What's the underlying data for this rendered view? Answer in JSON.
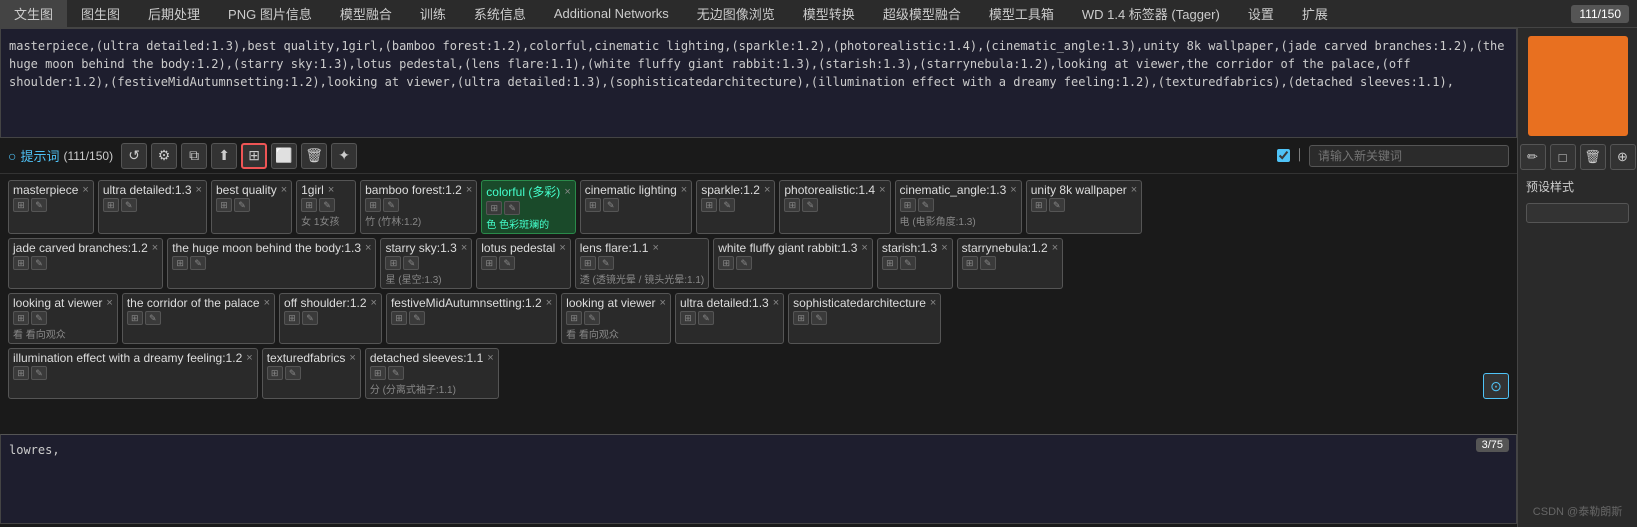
{
  "menu": {
    "items": [
      {
        "label": "文生图",
        "active": false
      },
      {
        "label": "图生图",
        "active": false
      },
      {
        "label": "后期处理",
        "active": false
      },
      {
        "label": "PNG 图片信息",
        "active": false
      },
      {
        "label": "模型融合",
        "active": false
      },
      {
        "label": "训练",
        "active": false
      },
      {
        "label": "系统信息",
        "active": false
      },
      {
        "label": "Additional Networks",
        "active": false
      },
      {
        "label": "无边图像浏览",
        "active": false
      },
      {
        "label": "模型转换",
        "active": false
      },
      {
        "label": "超级模型融合",
        "active": false
      },
      {
        "label": "模型工具箱",
        "active": false
      },
      {
        "label": "WD 1.4 标签器 (Tagger)",
        "active": false
      },
      {
        "label": "设置",
        "active": false
      },
      {
        "label": "扩展",
        "active": false
      }
    ],
    "counter": "111/150"
  },
  "positive_prompt": {
    "text": "masterpiece,(ultra detailed:1.3),best quality,1girl,(bamboo forest:1.2),colorful,cinematic lighting,(sparkle:1.2),(photorealistic:1.4),(cinematic_angle:1.3),unity 8k wallpaper,(jade carved branches:1.2),(the huge moon behind the body:1.2),(starry sky:1.3),lotus pedestal,(lens flare:1.1),(white fluffy giant rabbit:1.3),(starish:1.3),(starrynebula:1.2),looking at viewer,the corridor of the palace,(off shoulder:1.2),(festiveMidAutumnsetting:1.2),looking at viewer,(ultra detailed:1.3),(sophisticatedarchitecture),(illumination effect with a dreamy feeling:1.2),(texturedfabrics),(detached sleeves:1.1),"
  },
  "toolbar": {
    "prompt_label": "提示词",
    "prompt_count": "(111/150)",
    "keyword_placeholder": "请输入新关键词",
    "buttons": [
      {
        "id": "btn1",
        "icon": "↺",
        "title": "restore"
      },
      {
        "id": "btn2",
        "icon": "⚙",
        "title": "settings"
      },
      {
        "id": "btn3",
        "icon": "📋",
        "title": "copy"
      },
      {
        "id": "btn4",
        "icon": "⬆",
        "title": "import",
        "active": true
      },
      {
        "id": "btn5",
        "icon": "📄",
        "title": "page"
      },
      {
        "id": "btn6",
        "icon": "🗑",
        "title": "clear"
      },
      {
        "id": "btn7",
        "icon": "✨",
        "title": "magic"
      }
    ]
  },
  "tags_row1": [
    {
      "label": "masterpiece",
      "sub": "",
      "icons": 2
    },
    {
      "label": "ultra detailed:1.3",
      "sub": "",
      "icons": 2
    },
    {
      "label": "best quality",
      "sub": "",
      "icons": 2
    },
    {
      "label": "1girl",
      "sub": "女 1女孩",
      "icons": 2
    },
    {
      "label": "bamboo forest:1.2",
      "sub": "竹 (竹林:1.2)",
      "icons": 2
    },
    {
      "label": "colorful (多彩)",
      "colored": true,
      "sub": "色 色彩斑斓的",
      "icons": 2
    },
    {
      "label": "cinematic lighting",
      "sub": "",
      "icons": 2
    },
    {
      "label": "sparkle:1.2",
      "sub": "",
      "icons": 2
    },
    {
      "label": "photorealistic:1.4",
      "sub": "",
      "icons": 2
    },
    {
      "label": "cinematic_angle:1.3",
      "sub": "电 (电影角度:1.3)",
      "icons": 2
    },
    {
      "label": "unity 8k wallpaper",
      "sub": "",
      "icons": 2
    }
  ],
  "tags_row2": [
    {
      "label": "jade carved branches:1.2",
      "sub": "",
      "icons": 2
    },
    {
      "label": "the huge moon behind the body:1.3",
      "sub": "",
      "icons": 2
    },
    {
      "label": "starry sky:1.3",
      "sub": "星 (星空:1.3)",
      "icons": 2
    },
    {
      "label": "lotus pedestal",
      "sub": "",
      "icons": 2
    },
    {
      "label": "lens flare:1.1",
      "sub": "透 (透镜光晕 / 镜头光晕:1.1)",
      "icons": 2
    },
    {
      "label": "white fluffy giant rabbit:1.3",
      "sub": "",
      "icons": 2
    },
    {
      "label": "starish:1.3",
      "sub": "",
      "icons": 2
    },
    {
      "label": "starrynebula:1.2",
      "sub": "",
      "icons": 2
    }
  ],
  "tags_row3": [
    {
      "label": "looking at viewer",
      "sub": "看 看向观众",
      "icons": 2
    },
    {
      "label": "the corridor of the palace",
      "sub": "",
      "icons": 2
    },
    {
      "label": "off shoulder:1.2",
      "sub": "",
      "icons": 2
    },
    {
      "label": "festiveMidAutumnsetting:1.2",
      "sub": "",
      "icons": 2
    },
    {
      "label": "looking at viewer",
      "sub": "看 看向观众",
      "icons": 2
    },
    {
      "label": "ultra detailed:1.3",
      "sub": "",
      "icons": 2
    },
    {
      "label": "sophisticatedarchitecture",
      "sub": "",
      "icons": 2
    }
  ],
  "tags_row4": [
    {
      "label": "illumination effect with a dreamy feeling:1.2",
      "sub": "",
      "icons": 2
    },
    {
      "label": "texturedfabrics",
      "sub": "",
      "icons": 2
    },
    {
      "label": "detached sleeves:1.1",
      "sub": "分 (分离式袖子:1.1)",
      "icons": 2
    }
  ],
  "negative_prompt": {
    "text": "lowres,",
    "count": "3/75"
  },
  "right_panel": {
    "preset_label": "预设样式",
    "watermark": "CSDN @泰勒朗斯",
    "buttons": [
      {
        "icon": "✏",
        "label": "edit"
      },
      {
        "icon": "□",
        "label": "copy"
      },
      {
        "icon": "🗑",
        "label": "delete"
      },
      {
        "icon": "⊕",
        "label": "add"
      }
    ]
  },
  "scroll_btn": "⊙"
}
